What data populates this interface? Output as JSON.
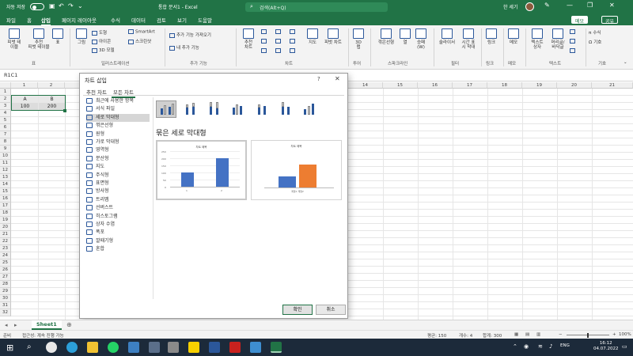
{
  "titlebar": {
    "autosave": "자동 저장",
    "doc_title": "통합 문서1 - Excel",
    "search_placeholder": "검색(Alt+Q)",
    "user": "한 세기"
  },
  "menu": {
    "tabs": [
      "파일",
      "홈",
      "삽입",
      "페이지 레이아웃",
      "수식",
      "데이터",
      "검토",
      "보기",
      "도움말"
    ],
    "memo_label": "메모",
    "share_label": "공유"
  },
  "ribbon": {
    "pivot": "피벗 테\n이블",
    "recommended_pivot": "추천\n피벗 테이블",
    "table": "표",
    "picture": "그림",
    "shapes": "도형",
    "icons": "아이콘",
    "models": "3D 모델",
    "smartart": "SmartArt",
    "screenshot": "스크린샷",
    "get_addins": "추가 기능 가져오기",
    "my_addins": "내 추가 기능",
    "recommended_charts": "추천\n차트",
    "maps": "지도",
    "pivot_chart": "피벗 차트",
    "map3d": "3D\n맵",
    "line": "꺾은선형",
    "column": "열",
    "winloss": "승패\n(W)",
    "slicer": "슬라이서",
    "timeline": "시간 표\n시 막대",
    "link": "링크",
    "comment": "메모",
    "textbox": "텍스트\n상자",
    "header_footer": "머리글/\n바닥글",
    "equation": "수식",
    "symbol": "기호",
    "groups": {
      "tables": "표",
      "illustrations": "일러스트레이션",
      "addins": "추가 기능",
      "charts": "차트",
      "tours": "투어",
      "sparklines": "스파크라인",
      "filters": "필터",
      "links": "링크",
      "comments": "메모",
      "text": "텍스트",
      "symbols": "기호"
    }
  },
  "formula": {
    "namebox": "R1C1"
  },
  "grid": {
    "row_numbers": [
      "1",
      "2",
      "3",
      "4",
      "5",
      "6",
      "7",
      "8",
      "9",
      "10",
      "11",
      "12",
      "13",
      "14",
      "15",
      "16",
      "17",
      "18",
      "19",
      "20",
      "21",
      "22",
      "23",
      "24",
      "25",
      "26",
      "27",
      "28",
      "29",
      "30",
      "31",
      "32"
    ],
    "visible_col_headers": {
      "c1": "1",
      "c2": "2",
      "c14": "14",
      "c15": "15",
      "c16": "16",
      "c17": "17",
      "c18": "18",
      "c19": "19",
      "c20": "20",
      "c21": "21",
      "c22": "22",
      "c23": "23"
    },
    "cells": {
      "r1c1": "A",
      "r1c2": "B",
      "r2c1": "100",
      "r2c2": "200"
    }
  },
  "dialog": {
    "title": "차트 삽입",
    "help": "?",
    "tabs": [
      "추천 차트",
      "모든 차트"
    ],
    "sidebar": [
      "최근에 사용한 항목",
      "서식 파일",
      "세로 막대형",
      "꺾은선형",
      "원형",
      "가로 막대형",
      "영역형",
      "분산형",
      "지도",
      "주식형",
      "표면형",
      "방사형",
      "트리맵",
      "선버스트",
      "히스토그램",
      "상자 수염",
      "폭포",
      "깔때기형",
      "혼합"
    ],
    "selected_type": "묶은 세로 막대형",
    "preview1": {
      "title": "차트 제목",
      "ticks": [
        "250",
        "200",
        "150",
        "100",
        "50",
        "0"
      ],
      "cats": [
        "1",
        "2"
      ]
    },
    "preview2": {
      "title": "차트 제목",
      "cat": "계열1 계열2"
    },
    "ok": "확인",
    "cancel": "취소"
  },
  "sheet": {
    "tab": "Sheet1"
  },
  "status": {
    "mode": "준비",
    "accessibility": "접근성: 계속 진행 가능",
    "average": "평균: 150",
    "count": "개수: 4",
    "sum": "합계: 300",
    "zoom": "100%"
  },
  "taskbar": {
    "time": "16:12",
    "date": "04.07.2022",
    "lang": "ENG"
  },
  "colors": {
    "excel_green": "#217346",
    "bar_blue": "#4472c4",
    "bar_orange": "#ed7d31"
  },
  "chart_data": [
    {
      "type": "bar",
      "title": "차트 제목",
      "categories": [
        "1",
        "2"
      ],
      "values": [
        100,
        200
      ],
      "ylim": [
        0,
        250
      ]
    }
  ]
}
